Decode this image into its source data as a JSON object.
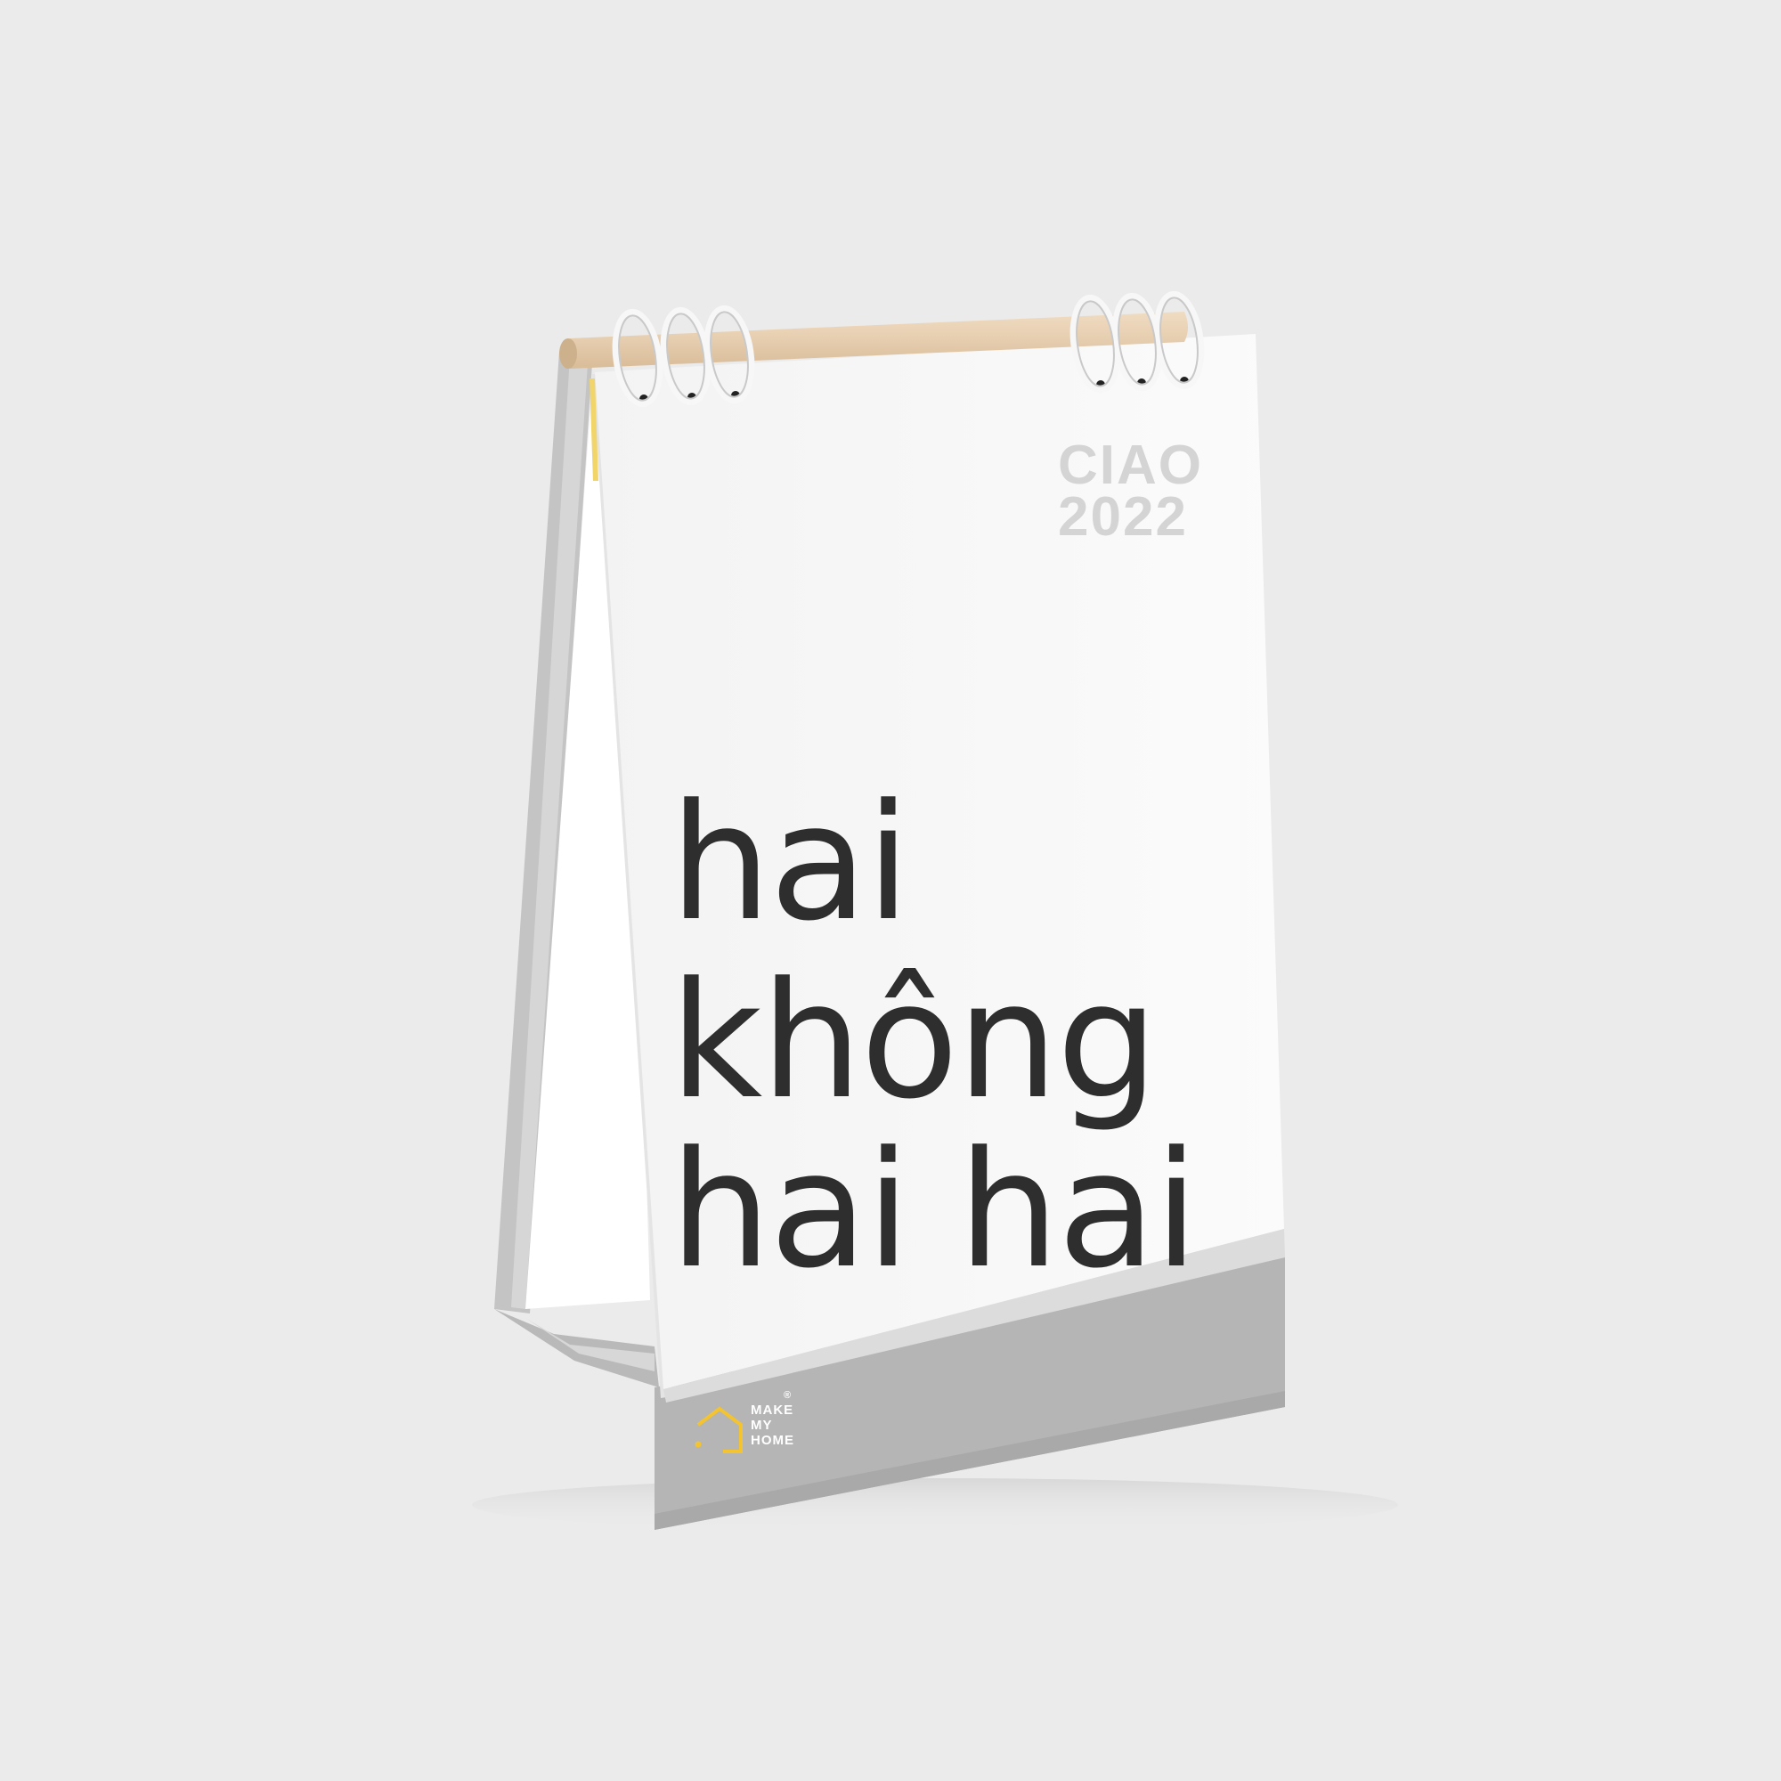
{
  "calendar": {
    "corner_text": [
      "CIAO",
      "2022"
    ],
    "main_text": [
      "hai",
      "không",
      "hai hai"
    ],
    "brand": {
      "lines": [
        "MAKE",
        "MY",
        "HOME"
      ],
      "registered": "®",
      "logo_color": "#f4c430"
    }
  },
  "colors": {
    "background": "#ebebeb",
    "page": "#fafafa",
    "stand": "#b4b4b4",
    "wood_rod": "#e8d2b6"
  }
}
